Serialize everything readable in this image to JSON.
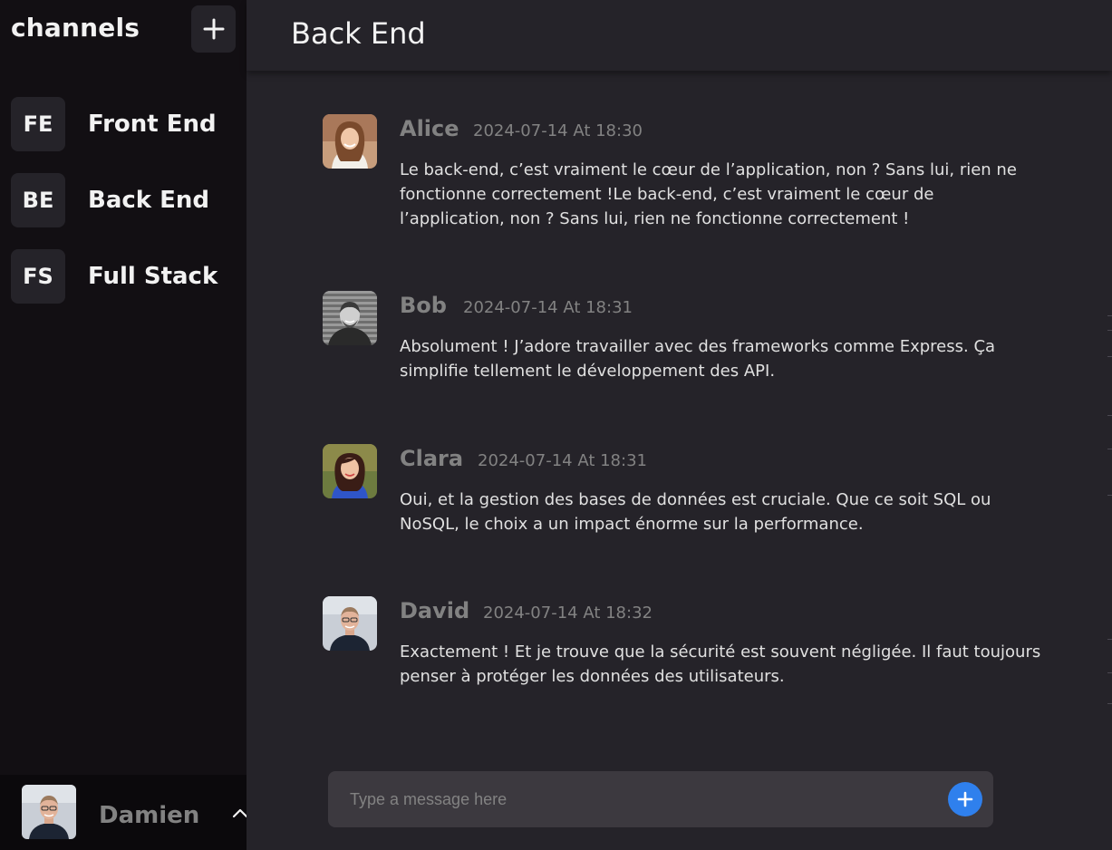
{
  "sidebar": {
    "title": "channels",
    "add_button_icon": "plus-icon",
    "channels": [
      {
        "abbr": "FE",
        "name": "Front End"
      },
      {
        "abbr": "BE",
        "name": "Back End"
      },
      {
        "abbr": "FS",
        "name": "Full Stack"
      }
    ],
    "current_user": {
      "name": "Damien",
      "menu_icon": "chevron-up-icon"
    }
  },
  "main": {
    "channel_title": "Back End",
    "messages": [
      {
        "author": "Alice",
        "time": "2024-07-14 At 18:30",
        "text": "Le back-end, c’est vraiment le cœur de l’application, non ? Sans lui, rien ne fonctionne correctement !Le back-end, c’est vraiment le cœur de l’application, non ? Sans lui, rien ne fonctionne correctement !"
      },
      {
        "author": "Bob",
        "time": "2024-07-14 At 18:31",
        "text": "Absolument ! J’adore travailler avec des frameworks comme Express. Ça simplifie tellement le développement des API."
      },
      {
        "author": "Clara",
        "time": "2024-07-14 At 18:31",
        "text": "Oui, et la gestion des bases de données est cruciale. Que ce soit SQL ou NoSQL, le choix a un impact énorme sur la performance."
      },
      {
        "author": "David",
        "time": "2024-07-14 At 18:32",
        "text": "Exactement ! Et je trouve que la sécurité est souvent négligée. Il faut toujours penser à protéger les données des utilisateurs."
      }
    ],
    "composer": {
      "placeholder": "Type a message here",
      "send_icon": "plus-icon"
    }
  },
  "colors": {
    "sidebar_bg": "#120f13",
    "main_bg": "#252329",
    "input_bg": "#3c393f",
    "accent": "#2f80ed",
    "muted_text": "#828282"
  }
}
